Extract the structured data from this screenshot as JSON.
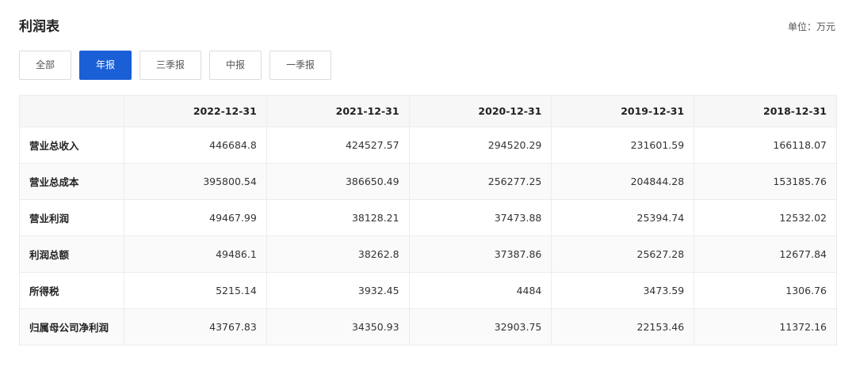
{
  "header": {
    "title": "利润表",
    "unit": "单位：万元"
  },
  "tabs": [
    {
      "label": "全部",
      "active": false
    },
    {
      "label": "年报",
      "active": true
    },
    {
      "label": "三季报",
      "active": false
    },
    {
      "label": "中报",
      "active": false
    },
    {
      "label": "一季报",
      "active": false
    }
  ],
  "table": {
    "columns": [
      "2022-12-31",
      "2021-12-31",
      "2020-12-31",
      "2019-12-31",
      "2018-12-31"
    ],
    "rows": [
      {
        "label": "营业总收入",
        "values": [
          "446684.8",
          "424527.57",
          "294520.29",
          "231601.59",
          "166118.07"
        ]
      },
      {
        "label": "营业总成本",
        "values": [
          "395800.54",
          "386650.49",
          "256277.25",
          "204844.28",
          "153185.76"
        ]
      },
      {
        "label": "营业利润",
        "values": [
          "49467.99",
          "38128.21",
          "37473.88",
          "25394.74",
          "12532.02"
        ]
      },
      {
        "label": "利润总额",
        "values": [
          "49486.1",
          "38262.8",
          "37387.86",
          "25627.28",
          "12677.84"
        ]
      },
      {
        "label": "所得税",
        "values": [
          "5215.14",
          "3932.45",
          "4484",
          "3473.59",
          "1306.76"
        ]
      },
      {
        "label": "归属母公司净利润",
        "values": [
          "43767.83",
          "34350.93",
          "32903.75",
          "22153.46",
          "11372.16"
        ]
      }
    ]
  },
  "colors": {
    "accent": "#1a5fd6",
    "header_bg": "#f7f7f7",
    "border": "#ececec"
  }
}
